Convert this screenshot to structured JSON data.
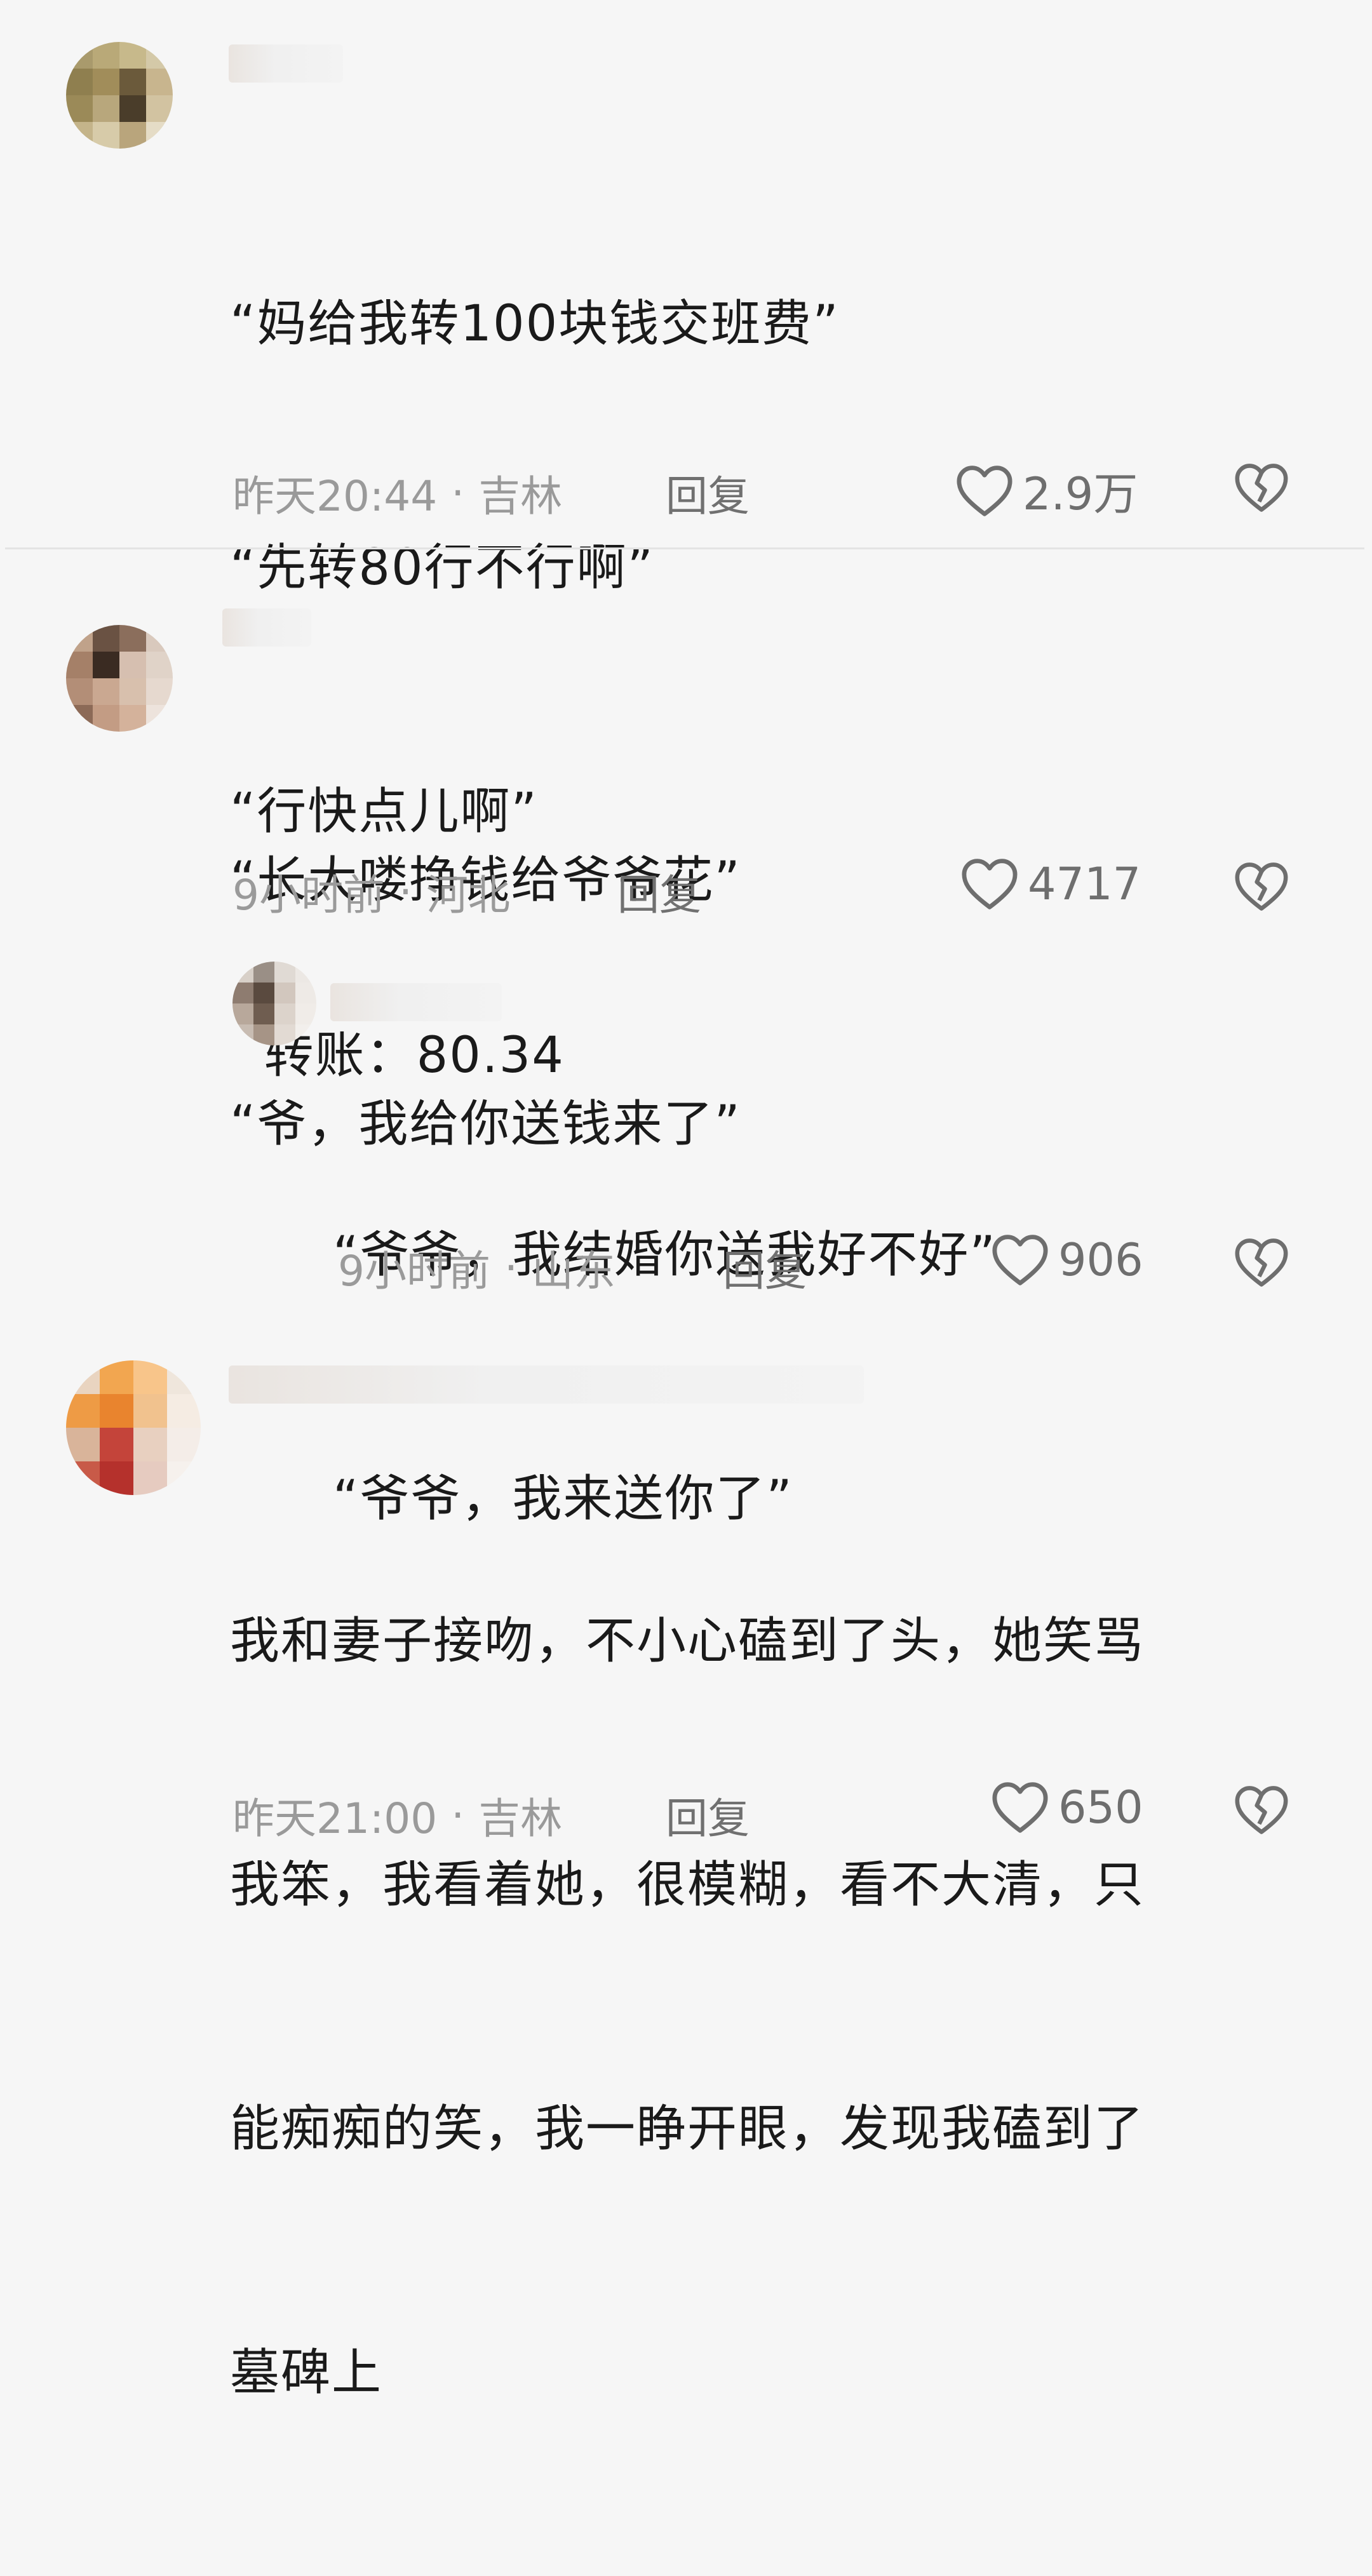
{
  "comments": [
    {
      "lines": [
        "“妈给我转100块钱交班费”",
        "“先转80行不行啊”",
        "“行快点儿啊”",
        "  转账：80.34"
      ],
      "time": "昨天20:44",
      "location": "吉林",
      "reply_label": "回复",
      "likes": "2.9万"
    },
    {
      "lines": [
        "“长大喽挣钱给爷爷花”",
        "“爷，我给你送钱来了”"
      ],
      "time": "9小时前",
      "location": "河北",
      "reply_label": "回复",
      "likes": "4717"
    },
    {
      "lines": [
        "“爷爷，我结婚你送我好不好”",
        "“爷爷，我来送你了”"
      ],
      "time": "9小时前",
      "location": "山东",
      "reply_label": "回复",
      "likes": "906"
    },
    {
      "lines": [
        "我和妻子接吻，不小心磕到了头，她笑骂",
        "我笨，我看着她，很模糊，看不大清，只",
        "能痴痴的笑，我一睁开眼，发现我磕到了",
        "墓碑上"
      ],
      "time": "昨天21:00",
      "location": "吉林",
      "reply_label": "回复",
      "likes": "650"
    }
  ],
  "meta_separator": "·",
  "icons": {
    "like": "heart-outline-icon",
    "dislike": "broken-heart-icon"
  },
  "colors": {
    "background": "#f6f6f6",
    "text": "#1a1a1a",
    "meta": "#9a9a9a"
  }
}
